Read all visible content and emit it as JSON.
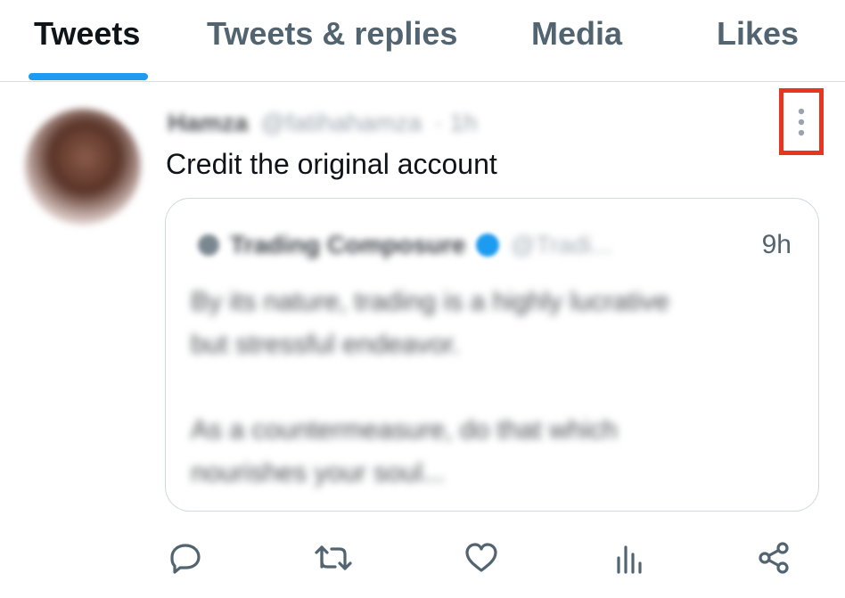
{
  "tabs": [
    {
      "label": "Tweets",
      "active": true
    },
    {
      "label": "Tweets & replies",
      "active": false
    },
    {
      "label": "Media",
      "active": false
    },
    {
      "label": "Likes",
      "active": false
    }
  ],
  "tweet": {
    "author_name": "Hamza",
    "author_handle": "@fatihahamza",
    "time": "· 1h",
    "text": "Credit the original account",
    "quoted": {
      "author_name": "Trading Composure",
      "author_handle": "@Tradi...",
      "verified": true,
      "time": "9h",
      "paragraphs": [
        [
          "By its nature, trading is a highly lucrative",
          "but stressful endeavor."
        ],
        [
          "As a countermeasure, do that which",
          "nourishes your soul..."
        ]
      ]
    },
    "actions": [
      "reply-icon",
      "retweet-icon",
      "like-icon",
      "views-icon",
      "share-icon"
    ]
  },
  "colors": {
    "accent": "#1d9bf0",
    "highlight_box": "#e8351f",
    "muted_text": "#536471",
    "border": "#cfd9de"
  }
}
